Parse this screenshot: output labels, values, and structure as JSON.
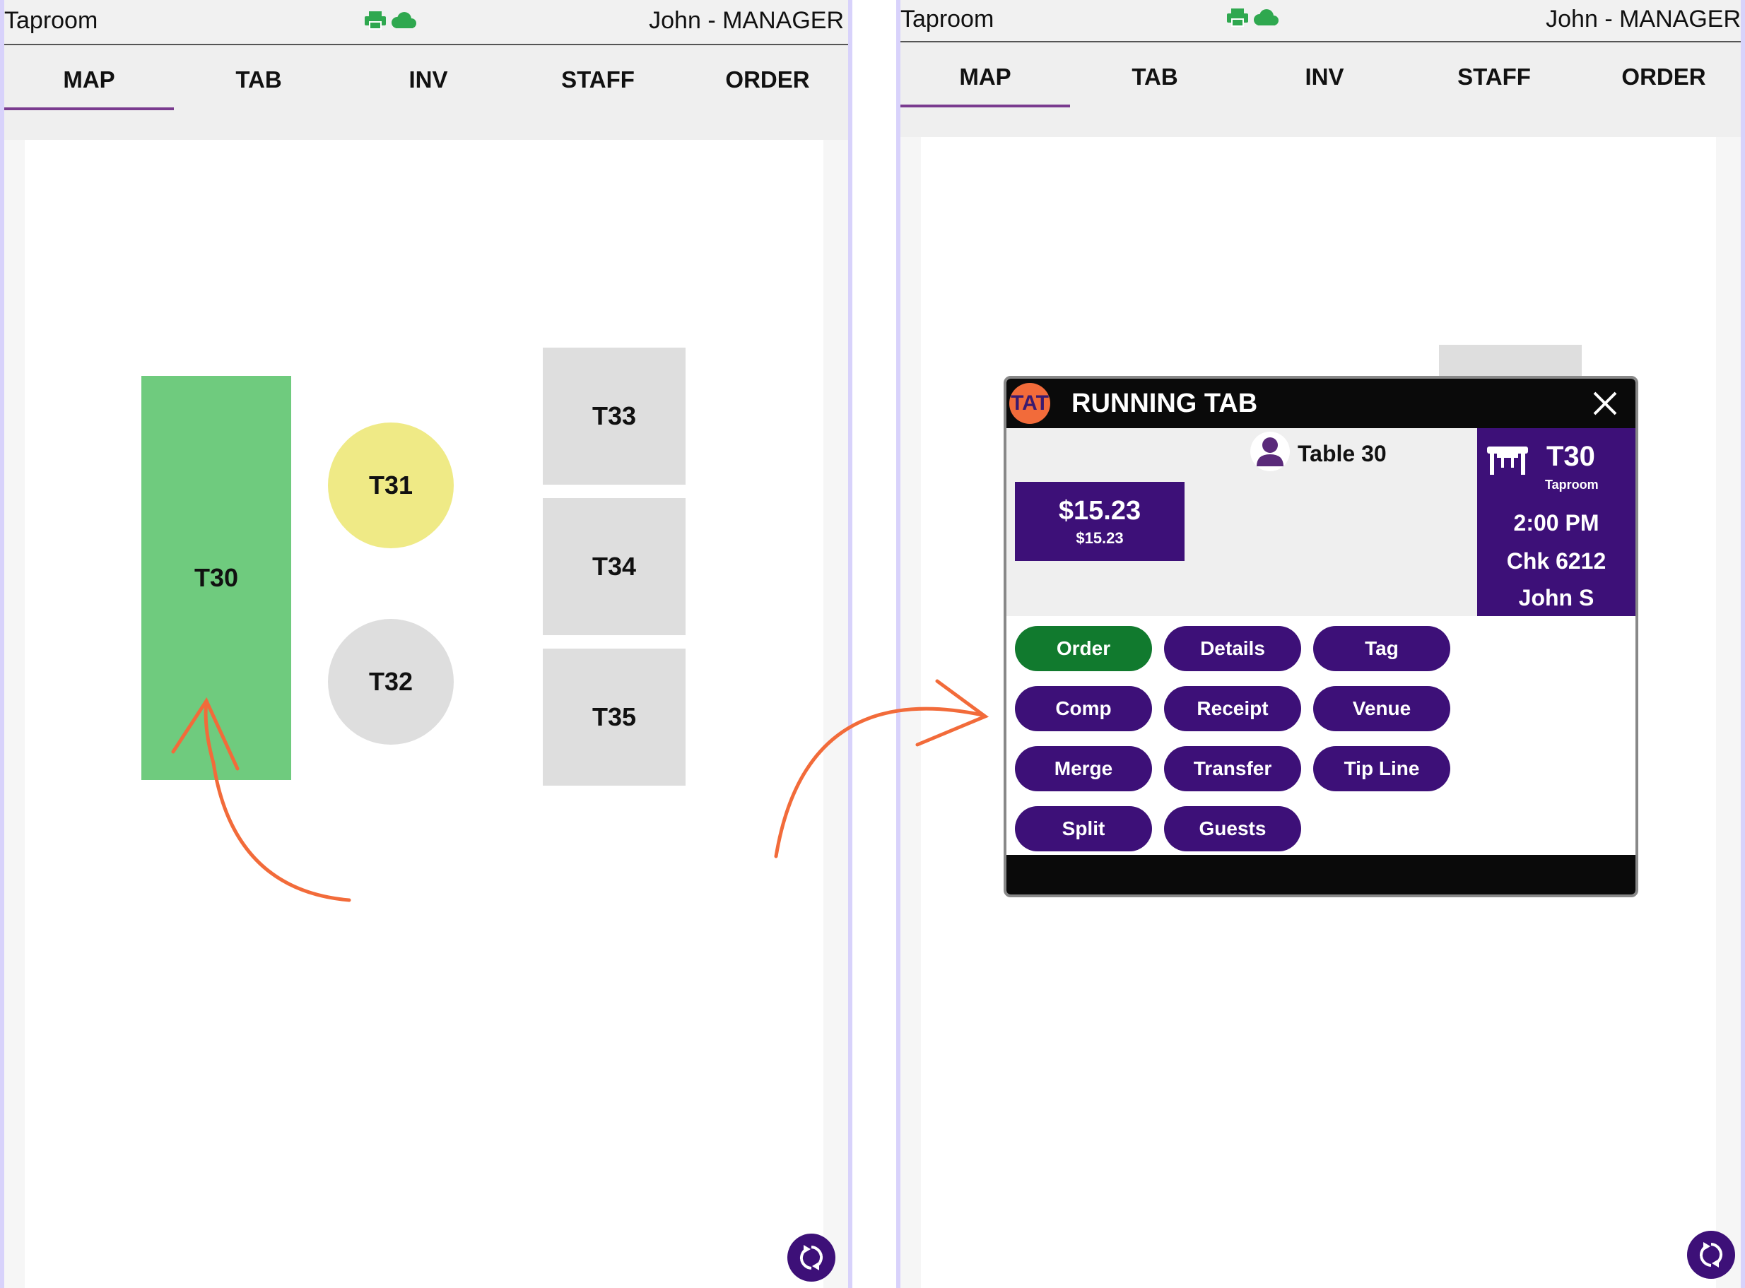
{
  "header": {
    "title": "Taproom",
    "user": "John - MANAGER",
    "icons": [
      "printer-icon",
      "cloud-icon"
    ],
    "icon_color": "#2fa84f"
  },
  "nav": {
    "tabs": [
      {
        "label": "MAP",
        "active": true
      },
      {
        "label": "TAB",
        "active": false
      },
      {
        "label": "INV",
        "active": false
      },
      {
        "label": "STAFF",
        "active": false
      },
      {
        "label": "ORDER",
        "active": false
      }
    ]
  },
  "tables": [
    {
      "label": "T30",
      "status_color": "#6fcb7e"
    },
    {
      "label": "T31",
      "status_color": "#efea86"
    },
    {
      "label": "T32",
      "status_color": "#dedede"
    },
    {
      "label": "T33",
      "status_color": "#dedede"
    },
    {
      "label": "T34",
      "status_color": "#dedede"
    },
    {
      "label": "T35",
      "status_color": "#dedede"
    }
  ],
  "dialog": {
    "logo": "TAT",
    "title": "RUNNING TAB",
    "table_name": "Table 30",
    "amount": "$15.23",
    "amount_sub": "$15.23",
    "table_code": "T30",
    "area": "Taproom",
    "time": "2:00 PM",
    "check": "Chk 6212",
    "server": "John S",
    "buttons": [
      "Order",
      "Details",
      "Tag",
      "Comp",
      "Receipt",
      "Venue",
      "Merge",
      "Transfer",
      "Tip Line",
      "Split",
      "Guests"
    ]
  },
  "colors": {
    "accent": "#3d1078",
    "order_green": "#117a2e",
    "nav_underline": "#7a3b8f",
    "annotation_arrow": "#f26b3a",
    "frame": "#d8d2fb"
  }
}
